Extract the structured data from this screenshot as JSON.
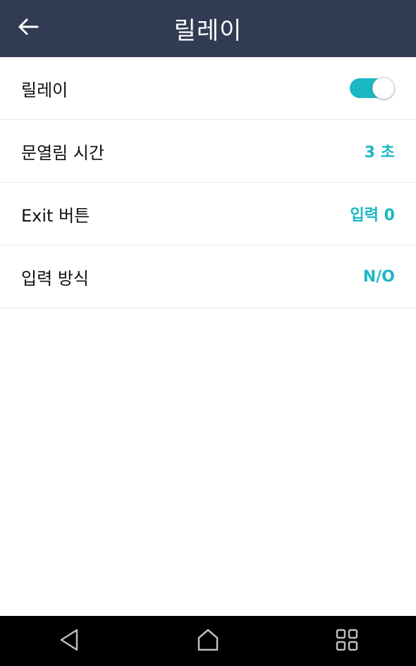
{
  "header": {
    "title": "릴레이",
    "back_icon": "arrow-left-icon"
  },
  "settings": [
    {
      "label": "릴레이",
      "type": "toggle",
      "value": true
    },
    {
      "label": "문열림 시간",
      "type": "value",
      "value": "3 초"
    },
    {
      "label": "Exit 버튼",
      "type": "value",
      "value": "입력 0"
    },
    {
      "label": "입력 방식",
      "type": "value",
      "value": "N/O"
    }
  ],
  "navbar": {
    "items": [
      "back-triangle-icon",
      "home-icon",
      "recent-apps-icon"
    ]
  },
  "colors": {
    "header_bg": "#323b54",
    "accent": "#1bb8c4",
    "navbar_bg": "#000000"
  }
}
